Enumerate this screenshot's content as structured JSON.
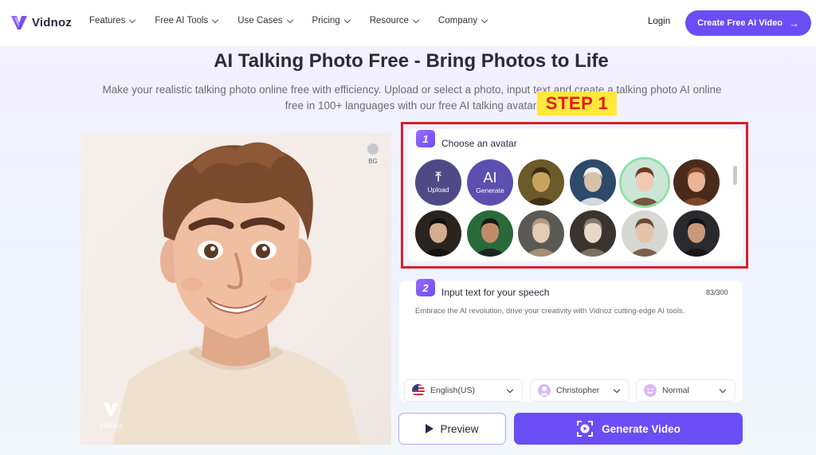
{
  "nav": {
    "logo_text": "Vidnoz",
    "menu": [
      "Features",
      "Free AI Tools",
      "Use Cases",
      "Pricing",
      "Resource",
      "Company"
    ],
    "login": "Login",
    "cta": "Create Free AI Video"
  },
  "hero": {
    "title": "AI Talking Photo Free - Bring Photos to Life",
    "subtitle": "Make your realistic talking photo online free with efficiency. Upload or select a photo, input text and create a talking photo AI online free in 100+ languages with our free AI talking avatar.",
    "step_label": "STEP 1"
  },
  "photo": {
    "bg_toggle": "BG",
    "watermark": "Vidnoz"
  },
  "step1": {
    "number": "1",
    "label": "Choose an avatar",
    "upload_label": "Upload",
    "generate_ai": "AI",
    "generate_label": "Generate",
    "avatars": [
      {
        "name": "mona-lisa",
        "colors": [
          "#6b5a2a",
          "#c9a35e",
          "#3a2a16"
        ]
      },
      {
        "name": "einstein",
        "colors": [
          "#2d4a6a",
          "#d7c2a8",
          "#f1f1f1"
        ]
      },
      {
        "name": "cartoon-man",
        "colors": [
          "#cbe6d6",
          "#f0c9b4",
          "#6b3a26"
        ]
      },
      {
        "name": "cartoon-woman",
        "colors": [
          "#4a2b1b",
          "#e8b596",
          "#8a4a2a"
        ]
      },
      {
        "name": "shakespeare",
        "colors": [
          "#2a2420",
          "#d3ae8e",
          "#111111"
        ]
      },
      {
        "name": "frida",
        "colors": [
          "#2a6a3a",
          "#c08a6a",
          "#1a1a1a"
        ]
      },
      {
        "name": "lady-hat",
        "colors": [
          "#5a5a55",
          "#e3cbb5",
          "#b39a7a"
        ]
      },
      {
        "name": "victorian-lady",
        "colors": [
          "#3a332e",
          "#e9d8c8",
          "#8b7a6a"
        ]
      },
      {
        "name": "young-man",
        "colors": [
          "#d7d7d4",
          "#e5c3a8",
          "#6a4a33"
        ]
      },
      {
        "name": "wonder-woman",
        "colors": [
          "#2a2a2e",
          "#c9977a",
          "#141414"
        ]
      }
    ]
  },
  "step2": {
    "number": "2",
    "label": "Input text for your speech",
    "counter": "83/300",
    "text": "Embrace the AI revolution, drive your creativity with Vidnoz cutting-edge AI tools.",
    "language": "English(US)",
    "voice": "Christopher",
    "style": "Normal"
  },
  "actions": {
    "preview": "Preview",
    "generate": "Generate Video"
  },
  "colors": {
    "brand": "#6a4df4",
    "highlight_box": "#d8202c",
    "step_label_bg": "#ffe83a",
    "step_label_text": "#e21b1b"
  }
}
